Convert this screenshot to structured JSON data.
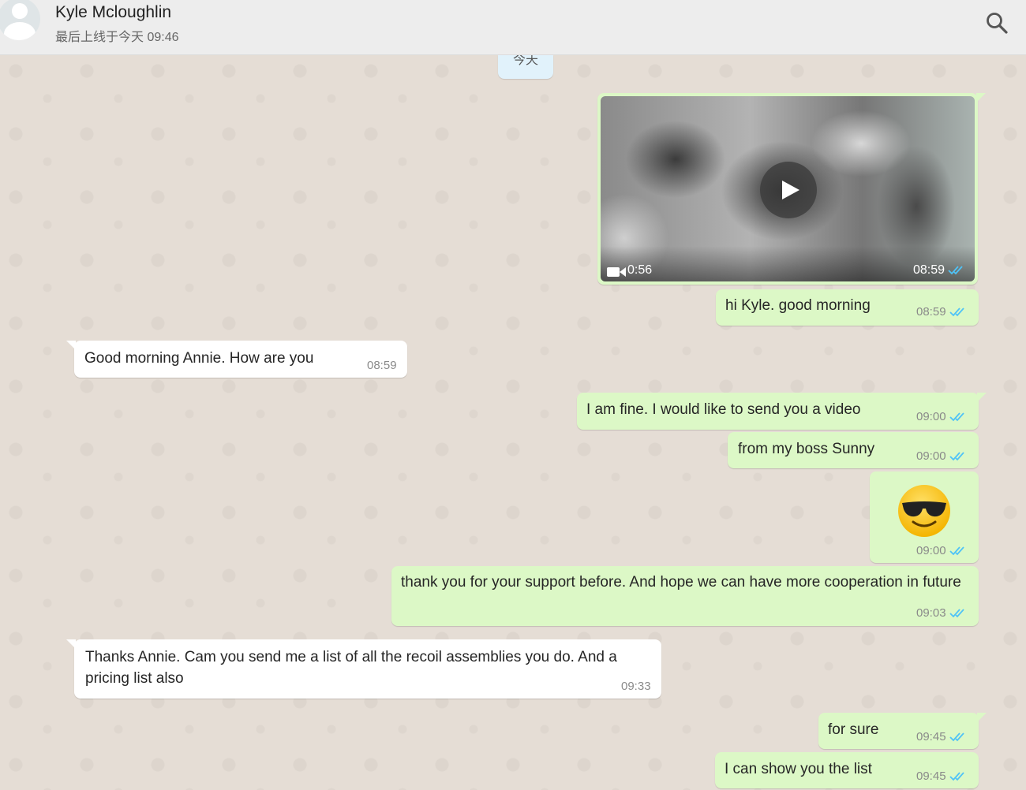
{
  "header": {
    "contact_name": "Kyle Mcloughlin",
    "last_seen": "最后上线于今天 09:46"
  },
  "chat": {
    "date_label": "今天",
    "video": {
      "duration": "0:56",
      "time": "08:59"
    },
    "messages": [
      {
        "dir": "out",
        "text": "hi Kyle. good morning",
        "time": "08:59"
      },
      {
        "dir": "in",
        "text": "Good morning Annie. How are you",
        "time": "08:59"
      },
      {
        "dir": "out",
        "text": "I am fine. I would like to send you a video",
        "time": "09:00"
      },
      {
        "dir": "out",
        "text": "from my boss Sunny",
        "time": "09:00"
      },
      {
        "dir": "out",
        "emoji": "smiling-face-with-sunglasses",
        "time": "09:00"
      },
      {
        "dir": "out",
        "text": "thank you for your support before. And hope we can have more cooperation in future",
        "time": "09:03"
      },
      {
        "dir": "in",
        "text": "Thanks Annie. Cam you send me a list of all the recoil assemblies you do. And a pricing list also",
        "time": "09:33"
      },
      {
        "dir": "out",
        "text": "for sure",
        "time": "09:45"
      },
      {
        "dir": "out",
        "text": "I can show you the list",
        "time": "09:45"
      }
    ]
  },
  "colors": {
    "outgoing": "#dcf8c6",
    "incoming": "#ffffff",
    "read_ticks": "#4fc3f7",
    "background": "#e5ddd5"
  }
}
